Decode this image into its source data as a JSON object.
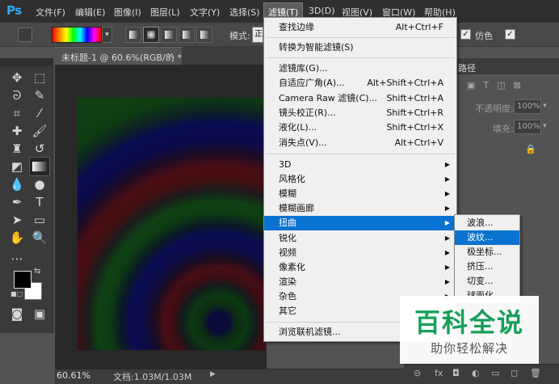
{
  "app": {
    "logo": "Ps",
    "menu": [
      "文件(F)",
      "编辑(E)",
      "图像(I)",
      "图层(L)",
      "文字(Y)",
      "选择(S)",
      "滤镜(T)",
      "3D(D)",
      "视图(V)",
      "窗口(W)",
      "帮助(H)"
    ]
  },
  "options_bar": {
    "mode_label": "模式:",
    "mode_value": "正",
    "dither_label": "仿色",
    "transparency_checked": "✓",
    "dither_checked": "✓"
  },
  "document": {
    "tab_title": "未标题-1 @ 60.6%(RGB/8) *",
    "tab_close": "×",
    "zoom": "60.61%",
    "doc_info": "文档:1.03M/1.03M"
  },
  "right_panel": {
    "tab_label": "路径",
    "opacity_label": "不透明度:",
    "opacity_value": "100%",
    "fill_label": "填充:",
    "fill_value": "100%"
  },
  "filter_menu": {
    "items": [
      {
        "label": "查找边缘",
        "shortcut": "Alt+Ctrl+F"
      },
      {
        "label": "转换为智能滤镜(S)",
        "shortcut": ""
      },
      {
        "label": "滤镜库(G)...",
        "shortcut": ""
      },
      {
        "label": "自适应广角(A)...",
        "shortcut": "Alt+Shift+Ctrl+A"
      },
      {
        "label": "Camera Raw 滤镜(C)...",
        "shortcut": "Shift+Ctrl+A"
      },
      {
        "label": "镜头校正(R)...",
        "shortcut": "Shift+Ctrl+R"
      },
      {
        "label": "液化(L)...",
        "shortcut": "Shift+Ctrl+X"
      },
      {
        "label": "消失点(V)...",
        "shortcut": "Alt+Ctrl+V"
      },
      {
        "label": "3D",
        "shortcut": ""
      },
      {
        "label": "风格化",
        "shortcut": ""
      },
      {
        "label": "模糊",
        "shortcut": ""
      },
      {
        "label": "模糊画廊",
        "shortcut": ""
      },
      {
        "label": "扭曲",
        "shortcut": ""
      },
      {
        "label": "锐化",
        "shortcut": ""
      },
      {
        "label": "视频",
        "shortcut": ""
      },
      {
        "label": "像素化",
        "shortcut": ""
      },
      {
        "label": "渲染",
        "shortcut": ""
      },
      {
        "label": "杂色",
        "shortcut": ""
      },
      {
        "label": "其它",
        "shortcut": ""
      },
      {
        "label": "浏览联机滤镜...",
        "shortcut": ""
      }
    ]
  },
  "distort_submenu": {
    "items": [
      "波浪...",
      "波纹...",
      "极坐标...",
      "挤压...",
      "切变...",
      "球面化..."
    ]
  },
  "watermark": {
    "title": "百科全说",
    "subtitle": "助你轻松解决"
  },
  "colors": {
    "accent": "#0a72d0",
    "ps_blue": "#31a8ff",
    "watermark_green": "#16a05a"
  }
}
